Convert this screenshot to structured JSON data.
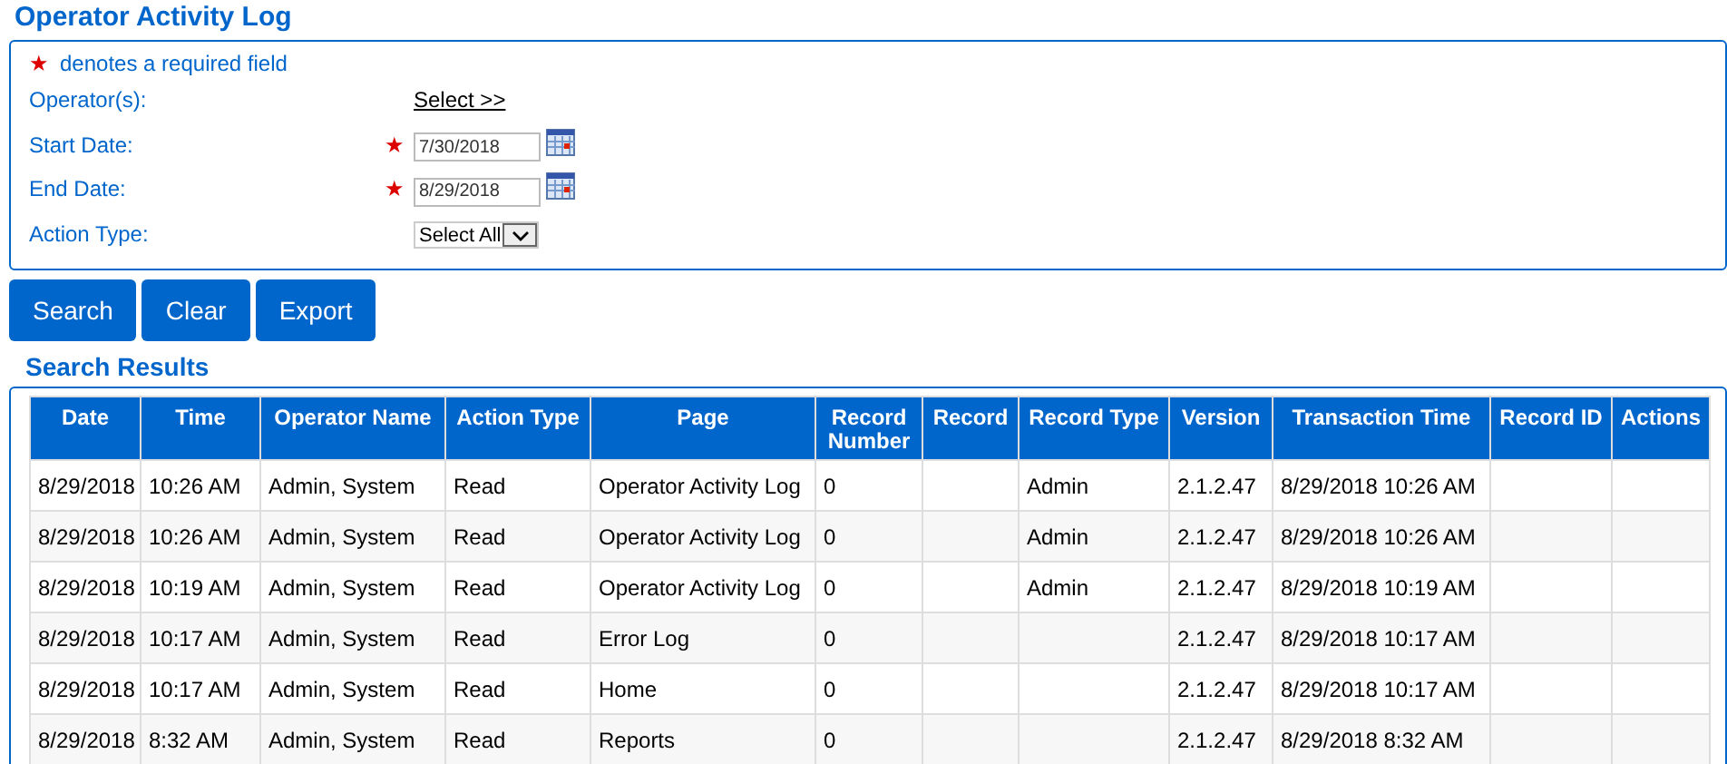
{
  "title": "Operator Activity Log",
  "required_note": {
    "marker": "★",
    "text": "denotes a required field"
  },
  "fields": [
    {
      "kind": "link",
      "label": "Operator(s):",
      "required": false,
      "value": "Select >>"
    },
    {
      "kind": "date",
      "label": "Start Date:",
      "required": true,
      "value": "7/30/2018"
    },
    {
      "kind": "date",
      "label": "End Date:",
      "required": true,
      "value": "8/29/2018"
    },
    {
      "kind": "select",
      "label": "Action Type:",
      "required": false,
      "value": "Select All"
    }
  ],
  "required_marker": "★",
  "buttons": [
    "Search",
    "Clear",
    "Export"
  ],
  "results_title": "Search Results",
  "table": {
    "columns": [
      "Date",
      "Time",
      "Operator Name",
      "Action Type",
      "Page",
      "Record Number",
      "Record",
      "Record Type",
      "Version",
      "Transaction Time",
      "Record ID",
      "Actions"
    ],
    "rows": [
      [
        "8/29/2018",
        "10:26 AM",
        "Admin, System",
        "Read",
        "Operator Activity Log",
        "0",
        "",
        "Admin",
        "2.1.2.47",
        "8/29/2018 10:26 AM",
        "",
        ""
      ],
      [
        "8/29/2018",
        "10:26 AM",
        "Admin, System",
        "Read",
        "Operator Activity Log",
        "0",
        "",
        "Admin",
        "2.1.2.47",
        "8/29/2018 10:26 AM",
        "",
        ""
      ],
      [
        "8/29/2018",
        "10:19 AM",
        "Admin, System",
        "Read",
        "Operator Activity Log",
        "0",
        "",
        "Admin",
        "2.1.2.47",
        "8/29/2018 10:19 AM",
        "",
        ""
      ],
      [
        "8/29/2018",
        "10:17 AM",
        "Admin, System",
        "Read",
        "Error Log",
        "0",
        "",
        "",
        "2.1.2.47",
        "8/29/2018 10:17 AM",
        "",
        ""
      ],
      [
        "8/29/2018",
        "10:17 AM",
        "Admin, System",
        "Read",
        "Home",
        "0",
        "",
        "",
        "2.1.2.47",
        "8/29/2018 10:17 AM",
        "",
        ""
      ],
      [
        "8/29/2018",
        "8:32 AM",
        "Admin, System",
        "Read",
        "Reports",
        "0",
        "",
        "",
        "2.1.2.47",
        "8/29/2018 8:32 AM",
        "",
        ""
      ]
    ]
  }
}
